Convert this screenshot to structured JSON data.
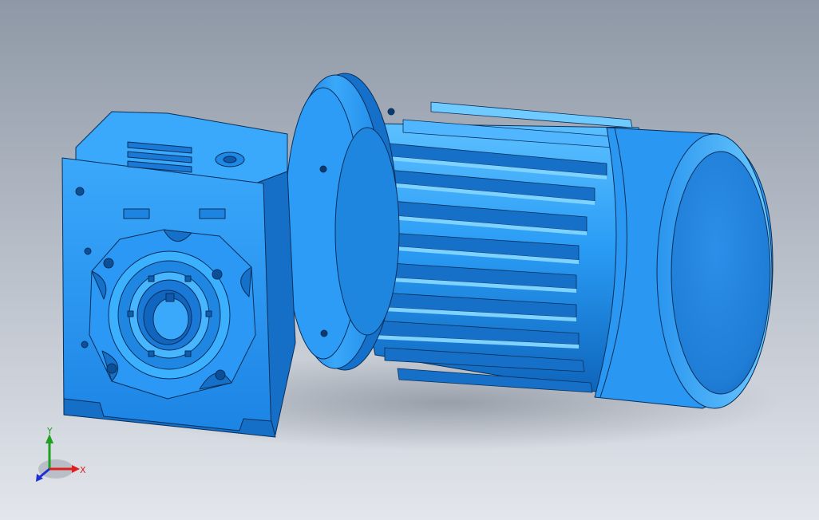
{
  "viewport": {
    "background_top": "#8e98a6",
    "background_bottom": "#e3e6ec"
  },
  "model": {
    "name": "",
    "color_main": "#1f93f2",
    "color_light": "#57b8ff",
    "color_dark": "#0f5fb0",
    "color_shadow": "#0b4a8f",
    "edge_color": "#0a2f5a"
  },
  "triad": {
    "x_label": "X",
    "y_label": "Y",
    "z_label": "Z",
    "x_color": "#e02020",
    "y_color": "#20a020",
    "z_color": "#2030d0"
  }
}
